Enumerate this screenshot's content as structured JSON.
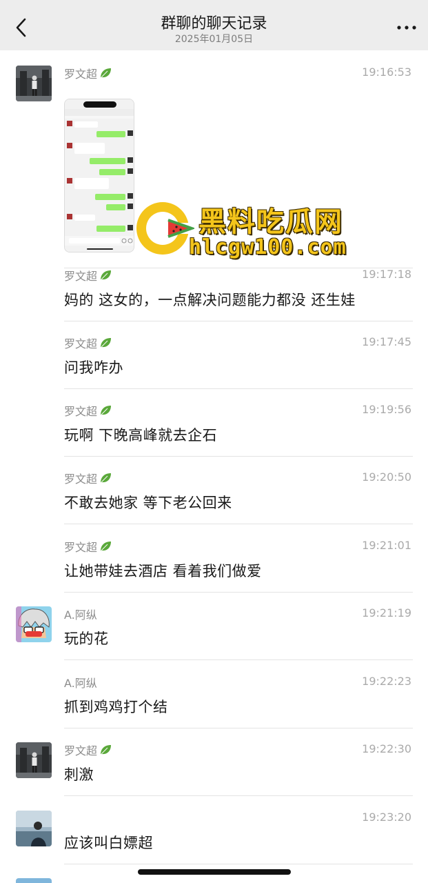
{
  "nav": {
    "title": "群聊的聊天记录",
    "subtitle": "2025年01月05日",
    "back_icon": "chevron-left-icon",
    "more_icon": "more-dots-icon"
  },
  "watermark": {
    "logo_text": "黑料吃瓜网",
    "url": "hlcgw100.com"
  },
  "messages": [
    {
      "sender": "罗文超",
      "time": "19:16:53",
      "text": ""
    },
    {
      "sender": "罗文超",
      "time": "19:17:18",
      "text": "妈的  这女的，一点解决问题能力都没   还生娃"
    },
    {
      "sender": "罗文超",
      "time": "19:17:45",
      "text": "问我咋办"
    },
    {
      "sender": "罗文超",
      "time": "19:19:56",
      "text": "玩啊  下晚高峰就去企石"
    },
    {
      "sender": "罗文超",
      "time": "19:20:50",
      "text": "不敢去她家  等下老公回来"
    },
    {
      "sender": "罗文超",
      "time": "19:21:01",
      "text": "让她带娃去酒店  看着我们做爱"
    },
    {
      "sender": "A.阿纵",
      "time": "19:21:19",
      "text": "玩的花"
    },
    {
      "sender": "A.阿纵",
      "time": "19:22:23",
      "text": "抓到鸡鸡打个结"
    },
    {
      "sender": "罗文超",
      "time": "19:22:30",
      "text": "刺激"
    },
    {
      "sender": "",
      "time": "19:23:20",
      "text": "应该叫白嫖超"
    }
  ],
  "colors": {
    "nav_bg": "#ededed",
    "leaf_green": "#5aa83a",
    "watermark_yellow": "#f4c51b"
  }
}
